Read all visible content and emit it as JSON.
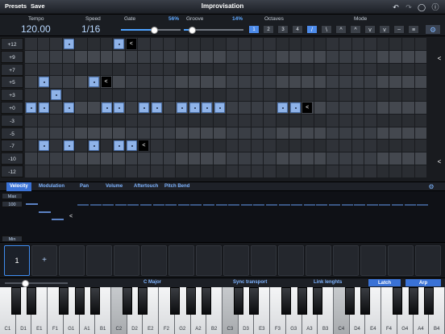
{
  "topbar": {
    "presets": "Presets",
    "save": "Save",
    "title": "Improvisation"
  },
  "controls": {
    "tempo_label": "Tempo",
    "tempo_value": "120.00",
    "speed_label": "Speed",
    "speed_value": "1/16",
    "gate_label": "Gate",
    "gate_pct": "56%",
    "gate_level": 0.56,
    "groove_label": "Groove",
    "groove_pct": "14%",
    "groove_level": 0.14,
    "octaves_label": "Octaves",
    "octaves": [
      "1",
      "2",
      "3",
      "4"
    ],
    "octave_selected": "1",
    "mode_label": "Mode",
    "modes": [
      "/",
      "\\",
      "^",
      "^",
      "v",
      "v",
      "~",
      "≡"
    ],
    "mode_selected": 0
  },
  "grid": {
    "rows": [
      "+12",
      "+9",
      "+7",
      "+5",
      "+3",
      "+0",
      "-3",
      "-5",
      "-7",
      "-10",
      "-12"
    ],
    "notes": [
      [
        0,
        3
      ],
      [
        0,
        7
      ],
      [
        3,
        1
      ],
      [
        3,
        5
      ],
      [
        4,
        2
      ],
      [
        5,
        0
      ],
      [
        5,
        1
      ],
      [
        5,
        3
      ],
      [
        5,
        6
      ],
      [
        5,
        7
      ],
      [
        5,
        9
      ],
      [
        5,
        10
      ],
      [
        5,
        12
      ],
      [
        5,
        13
      ],
      [
        5,
        14
      ],
      [
        5,
        15
      ],
      [
        5,
        20
      ],
      [
        5,
        21
      ],
      [
        8,
        1
      ],
      [
        8,
        3
      ],
      [
        8,
        5
      ],
      [
        8,
        7
      ],
      [
        8,
        8
      ]
    ],
    "cursors": [
      [
        0,
        8
      ],
      [
        3,
        6
      ],
      [
        5,
        22
      ],
      [
        8,
        9
      ]
    ],
    "cursor_glyph": "<"
  },
  "tabs": [
    "Velocity",
    "Modulation",
    "Pan",
    "Volume",
    "Aftertouch",
    "Pitch Bend"
  ],
  "velocity": {
    "max": "Max",
    "value": "100",
    "min": "Min"
  },
  "slots": {
    "selected": "1",
    "add": "+"
  },
  "bottombar": {
    "scale": "C Major",
    "sync": "Sync transport",
    "link": "Link lenghts",
    "latch": "Latch",
    "arp": "Arp"
  },
  "keyboard": {
    "white_keys": [
      "C1",
      "D1",
      "E1",
      "F1",
      "G1",
      "A1",
      "B1",
      "C2",
      "D2",
      "E2",
      "F2",
      "G2",
      "A2",
      "B2",
      "C3",
      "D3",
      "E3",
      "F3",
      "G3",
      "A3",
      "B3",
      "C4",
      "D4",
      "E4",
      "F4",
      "G4",
      "A4",
      "B4"
    ],
    "highlighted": [
      "C2",
      "C3",
      "C4"
    ]
  },
  "colors": {
    "accent": "#3a72d6",
    "note": "#8fb3e8",
    "value_text": "#b9d8ff",
    "pct": "#5fa8ff"
  }
}
